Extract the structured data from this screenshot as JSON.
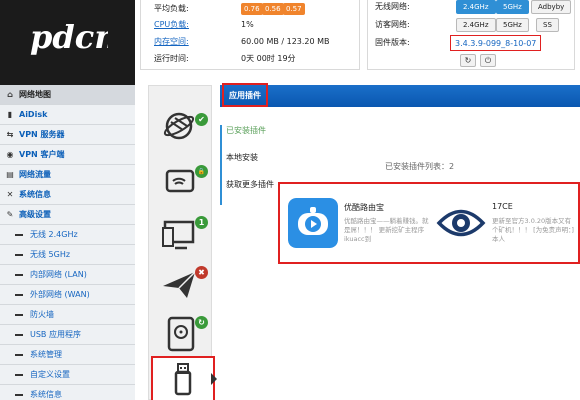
{
  "brand": {
    "logo_text": "pdcn"
  },
  "status": {
    "load_label": "平均负载:",
    "load_values": [
      "0.76",
      "0.56",
      "0.57"
    ],
    "cpu_label": "CPU负载:",
    "cpu_value": "1%",
    "mem_label": "内存空间:",
    "mem_value": "60.00 MB / 123.20 MB",
    "uptime_label": "运行时间:",
    "uptime_value": "0天 00时 19分"
  },
  "network": {
    "wireless_label": "无线网络:",
    "wireless_btns": [
      "2.4GHz",
      "5GHz",
      "Adbyby"
    ],
    "guest_label": "访客网络:",
    "guest_btns": [
      "2.4GHz",
      "5GHz",
      "SS"
    ],
    "firmware_label": "固件版本:",
    "firmware_value": "3.4.3.9-099_8-10-07",
    "refresh_icon": "↻",
    "power_icon": "⏻"
  },
  "menu": [
    {
      "label": "网络地图",
      "icon": "⌂",
      "type": "sec active"
    },
    {
      "label": "AiDisk",
      "icon": "▮",
      "type": "sec"
    },
    {
      "label": "VPN 服务器",
      "icon": "⇆",
      "type": "sec"
    },
    {
      "label": "VPN 客户端",
      "icon": "◉",
      "type": "sec"
    },
    {
      "label": "网络流量",
      "icon": "▤",
      "type": "sec"
    },
    {
      "label": "系统信息",
      "icon": "✕",
      "type": "sec"
    },
    {
      "label": "高级设置",
      "icon": "✎",
      "type": "sec"
    },
    {
      "label": "无线 2.4GHz",
      "type": "sub"
    },
    {
      "label": "无线 5GHz",
      "type": "sub"
    },
    {
      "label": "内部网络 (LAN)",
      "type": "sub"
    },
    {
      "label": "外部网络 (WAN)",
      "type": "sub"
    },
    {
      "label": "防火墙",
      "type": "sub"
    },
    {
      "label": "USB 应用程序",
      "type": "sub"
    },
    {
      "label": "系统管理",
      "type": "sub"
    },
    {
      "label": "自定义设置",
      "type": "sub"
    },
    {
      "label": "系统信息",
      "type": "sub"
    }
  ],
  "badges": {
    "check": "✔",
    "lock": "🔒",
    "count": "1",
    "cross": "✖",
    "refresh": "↻"
  },
  "panel": {
    "title": "应用插件",
    "side_items": [
      "已安装插件",
      "本地安装",
      "获取更多插件"
    ],
    "list_label": "已安装插件列表：2",
    "cards": [
      {
        "name": "优酷路由宝",
        "desc": "优酷路由宝——躺着赚钱。就是屌！！！ 更新挖矿主程序ikuacc到"
      },
      {
        "name": "17CE",
        "desc": "更新至官方3.0.20版本又有个矿机！！！ [为免责声明：] 本人"
      }
    ]
  },
  "colors": {
    "accent": "#2f8fd5",
    "highlight": "#e02020",
    "load": "#f0842c",
    "header_blue": "#0a57b0"
  }
}
